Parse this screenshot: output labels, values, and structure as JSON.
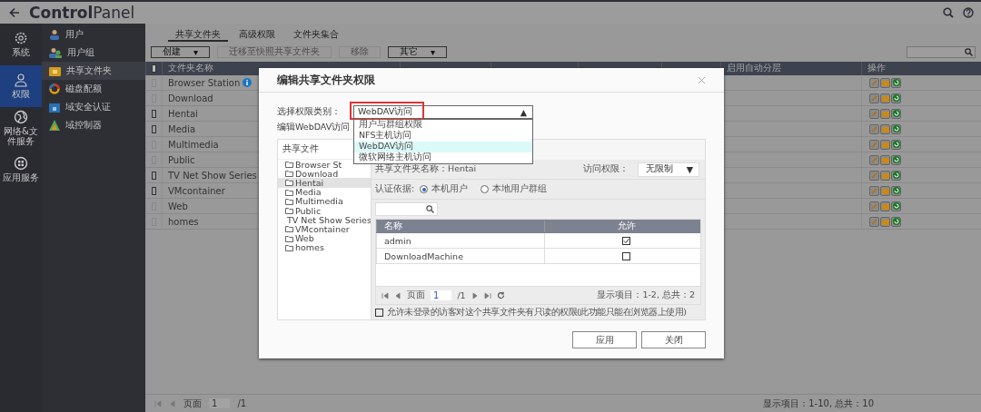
{
  "app": {
    "title_bold": "Control",
    "title_light": "Panel"
  },
  "nav": [
    {
      "label": "系统",
      "selected": false
    },
    {
      "label": "权限",
      "selected": true
    },
    {
      "label": "网络&文件服务",
      "selected": false
    },
    {
      "label": "应用服务",
      "selected": false
    }
  ],
  "submenu": [
    {
      "label": "用户",
      "selected": false
    },
    {
      "label": "用户组",
      "selected": false
    },
    {
      "label": "共享文件夹",
      "selected": true
    },
    {
      "label": "磁盘配额",
      "selected": false
    },
    {
      "label": "域安全认证",
      "selected": false
    },
    {
      "label": "域控制器",
      "selected": false
    }
  ],
  "tabs": [
    {
      "label": "共享文件夹",
      "selected": true
    },
    {
      "label": "高级权限",
      "selected": false
    },
    {
      "label": "文件夹集合",
      "selected": false
    }
  ],
  "toolbar": [
    {
      "label": "创建",
      "caret": "▾",
      "disabled": false
    },
    {
      "label": "迁移至快照共享文件夹",
      "disabled": true
    },
    {
      "label": "移除",
      "disabled": true
    },
    {
      "label": "其它",
      "caret": "▾",
      "disabled": false
    }
  ],
  "table": {
    "header_checkbox": {
      "checked": false
    },
    "columns": [
      "文件夹名称",
      "启用自动分层",
      "操作"
    ],
    "rows": [
      {
        "name": "Browser Station",
        "info": true,
        "disabled": true
      },
      {
        "name": "Download",
        "info": false,
        "disabled": true
      },
      {
        "name": "Hentai",
        "info": false,
        "disabled": false
      },
      {
        "name": "Media",
        "info": false,
        "disabled": false
      },
      {
        "name": "Multimedia",
        "info": false,
        "disabled": true
      },
      {
        "name": "Public",
        "info": false,
        "disabled": true
      },
      {
        "name": "TV Net Show Series",
        "info": false,
        "disabled": false
      },
      {
        "name": "VMcontainer",
        "info": false,
        "disabled": false
      },
      {
        "name": "Web",
        "info": false,
        "disabled": true
      },
      {
        "name": "homes",
        "info": false,
        "disabled": true
      }
    ]
  },
  "pager": {
    "page_label": "页面",
    "page": "1",
    "total": "/1",
    "summary": "显示项目：1-10, 总共：10"
  },
  "dialog": {
    "title": "编辑共享文件夹权限",
    "type_label": "选择权限类别：",
    "type_value": "WebDAV访问",
    "type_caret": "▲",
    "options": [
      {
        "label": "用户与群组权限",
        "selected": false
      },
      {
        "label": "NFS主机访问",
        "selected": false
      },
      {
        "label": "WebDAV访问",
        "selected": true
      },
      {
        "label": "微软网络主机访问",
        "selected": false
      }
    ],
    "edit_label": "编辑WebDAV访问",
    "tree_header": "共享文件",
    "tree": [
      {
        "name": "Browser St",
        "selected": false
      },
      {
        "name": "Download",
        "selected": false
      },
      {
        "name": "Hentai",
        "selected": true
      },
      {
        "name": "Media",
        "selected": false
      },
      {
        "name": "Multimedia",
        "selected": false
      },
      {
        "name": "Public",
        "selected": false
      },
      {
        "name": "TV Net Show Series",
        "selected": false
      },
      {
        "name": "VMcontainer",
        "selected": false
      },
      {
        "name": "Web",
        "selected": false
      },
      {
        "name": "homes",
        "selected": false
      }
    ],
    "folder_label": "共享文件夹名称：Hentai",
    "access_label": "访问权限：",
    "access_value": "无限制",
    "access_caret": "▼",
    "auth_label": "认证依据:",
    "auth_options": [
      {
        "label": "本机用户",
        "selected": true
      },
      {
        "label": "本地用户群组",
        "selected": false
      }
    ],
    "columns": [
      "名称",
      "允许"
    ],
    "users": [
      {
        "name": "admin",
        "checked": true
      },
      {
        "name": "DownloadMachine",
        "checked": false
      }
    ],
    "pager": {
      "page_label": "页面",
      "page": "1",
      "total": "/1",
      "summary": "显示项目：1-2, 总共：2"
    },
    "guest": {
      "label": "允许未登录的访客对这个共享文件夹有只读的权限(此功能只能在浏览器上使用)",
      "checked": false
    },
    "buttons": [
      "应用",
      "关闭"
    ]
  }
}
